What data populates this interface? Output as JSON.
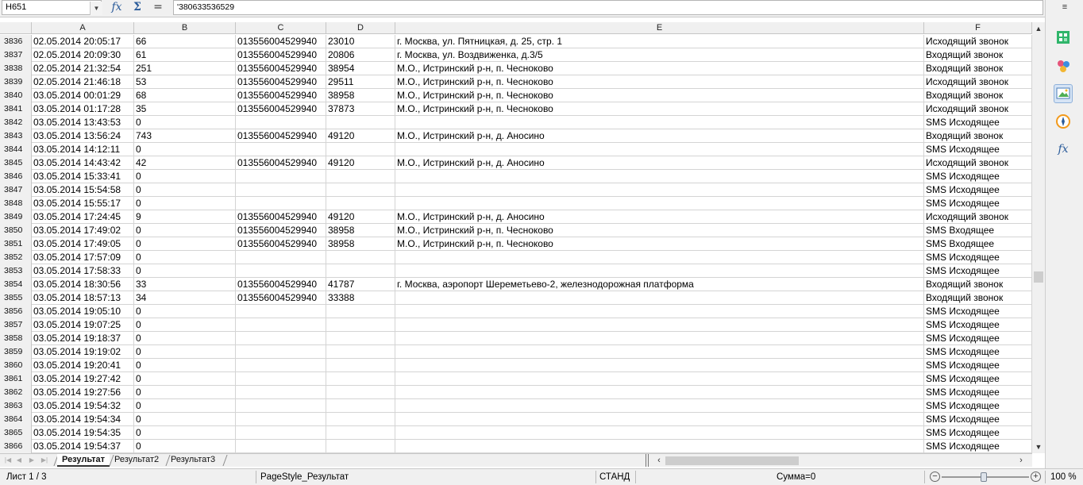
{
  "formula_bar": {
    "name_box": "H651",
    "formula_value": "'380633536529",
    "fx_label": "fx",
    "sum_label": "Σ",
    "equals_label": "="
  },
  "columns": [
    "A",
    "B",
    "C",
    "D",
    "E",
    "F"
  ],
  "rows": [
    {
      "n": "3836",
      "a": "02.05.2014 20:05:17",
      "b": "66",
      "c": "013556004529940",
      "d": "23010",
      "e": "г. Москва, ул. Пятницкая, д. 25, стр. 1",
      "f": "Исходящий звонок"
    },
    {
      "n": "3837",
      "a": "02.05.2014 20:09:30",
      "b": "61",
      "c": "013556004529940",
      "d": "20806",
      "e": "г. Москва, ул. Воздвиженка, д.3/5",
      "f": "Входящий звонок"
    },
    {
      "n": "3838",
      "a": "02.05.2014 21:32:54",
      "b": "251",
      "c": "013556004529940",
      "d": "38954",
      "e": "М.О., Истринский р-н, п. Чесноково",
      "f": "Входящий звонок"
    },
    {
      "n": "3839",
      "a": "02.05.2014 21:46:18",
      "b": "53",
      "c": "013556004529940",
      "d": "29511",
      "e": "М.О., Истринский р-н, п. Чесноково",
      "f": "Исходящий звонок"
    },
    {
      "n": "3840",
      "a": "03.05.2014 00:01:29",
      "b": "68",
      "c": "013556004529940",
      "d": "38958",
      "e": "М.О., Истринский р-н, п. Чесноково",
      "f": "Входящий звонок"
    },
    {
      "n": "3841",
      "a": "03.05.2014 01:17:28",
      "b": "35",
      "c": "013556004529940",
      "d": "37873",
      "e": "М.О., Истринский р-н, п. Чесноково",
      "f": "Исходящий звонок"
    },
    {
      "n": "3842",
      "a": "03.05.2014 13:43:53",
      "b": "0",
      "c": "",
      "d": "",
      "e": "",
      "f": "SMS Исходящее"
    },
    {
      "n": "3843",
      "a": "03.05.2014 13:56:24",
      "b": "743",
      "c": "013556004529940",
      "d": "49120",
      "e": "М.О., Истринский р-н, д. Аносино",
      "f": "Входящий звонок"
    },
    {
      "n": "3844",
      "a": "03.05.2014 14:12:11",
      "b": "0",
      "c": "",
      "d": "",
      "e": "",
      "f": "SMS Исходящее"
    },
    {
      "n": "3845",
      "a": "03.05.2014 14:43:42",
      "b": "42",
      "c": "013556004529940",
      "d": "49120",
      "e": "М.О., Истринский р-н, д. Аносино",
      "f": "Исходящий звонок"
    },
    {
      "n": "3846",
      "a": "03.05.2014 15:33:41",
      "b": "0",
      "c": "",
      "d": "",
      "e": "",
      "f": "SMS Исходящее"
    },
    {
      "n": "3847",
      "a": "03.05.2014 15:54:58",
      "b": "0",
      "c": "",
      "d": "",
      "e": "",
      "f": "SMS Исходящее"
    },
    {
      "n": "3848",
      "a": "03.05.2014 15:55:17",
      "b": "0",
      "c": "",
      "d": "",
      "e": "",
      "f": "SMS Исходящее"
    },
    {
      "n": "3849",
      "a": "03.05.2014 17:24:45",
      "b": "9",
      "c": "013556004529940",
      "d": "49120",
      "e": "М.О., Истринский р-н, д. Аносино",
      "f": "Исходящий звонок"
    },
    {
      "n": "3850",
      "a": "03.05.2014 17:49:02",
      "b": "0",
      "c": "013556004529940",
      "d": "38958",
      "e": "М.О., Истринский р-н, п. Чесноково",
      "f": "SMS Входящее"
    },
    {
      "n": "3851",
      "a": "03.05.2014 17:49:05",
      "b": "0",
      "c": "013556004529940",
      "d": "38958",
      "e": "М.О., Истринский р-н, п. Чесноково",
      "f": "SMS Входящее"
    },
    {
      "n": "3852",
      "a": "03.05.2014 17:57:09",
      "b": "0",
      "c": "",
      "d": "",
      "e": "",
      "f": "SMS Исходящее"
    },
    {
      "n": "3853",
      "a": "03.05.2014 17:58:33",
      "b": "0",
      "c": "",
      "d": "",
      "e": "",
      "f": "SMS Исходящее"
    },
    {
      "n": "3854",
      "a": "03.05.2014 18:30:56",
      "b": "33",
      "c": "013556004529940",
      "d": "41787",
      "e": "г. Москва, аэропорт Шереметьево-2, железнодорожная платформа",
      "f": "Входящий звонок"
    },
    {
      "n": "3855",
      "a": "03.05.2014 18:57:13",
      "b": "34",
      "c": "013556004529940",
      "d": "33388",
      "e": "",
      "f": "Входящий звонок"
    },
    {
      "n": "3856",
      "a": "03.05.2014 19:05:10",
      "b": "0",
      "c": "",
      "d": "",
      "e": "",
      "f": "SMS Исходящее"
    },
    {
      "n": "3857",
      "a": "03.05.2014 19:07:25",
      "b": "0",
      "c": "",
      "d": "",
      "e": "",
      "f": "SMS Исходящее"
    },
    {
      "n": "3858",
      "a": "03.05.2014 19:18:37",
      "b": "0",
      "c": "",
      "d": "",
      "e": "",
      "f": "SMS Исходящее"
    },
    {
      "n": "3859",
      "a": "03.05.2014 19:19:02",
      "b": "0",
      "c": "",
      "d": "",
      "e": "",
      "f": "SMS Исходящее"
    },
    {
      "n": "3860",
      "a": "03.05.2014 19:20:41",
      "b": "0",
      "c": "",
      "d": "",
      "e": "",
      "f": "SMS Исходящее"
    },
    {
      "n": "3861",
      "a": "03.05.2014 19:27:42",
      "b": "0",
      "c": "",
      "d": "",
      "e": "",
      "f": "SMS Исходящее"
    },
    {
      "n": "3862",
      "a": "03.05.2014 19:27:56",
      "b": "0",
      "c": "",
      "d": "",
      "e": "",
      "f": "SMS Исходящее"
    },
    {
      "n": "3863",
      "a": "03.05.2014 19:54:32",
      "b": "0",
      "c": "",
      "d": "",
      "e": "",
      "f": "SMS Исходящее"
    },
    {
      "n": "3864",
      "a": "03.05.2014 19:54:34",
      "b": "0",
      "c": "",
      "d": "",
      "e": "",
      "f": "SMS Исходящее"
    },
    {
      "n": "3865",
      "a": "03.05.2014 19:54:35",
      "b": "0",
      "c": "",
      "d": "",
      "e": "",
      "f": "SMS Исходящее"
    },
    {
      "n": "3866",
      "a": "03.05.2014 19:54:37",
      "b": "0",
      "c": "",
      "d": "",
      "e": "",
      "f": "SMS Исходящее"
    }
  ],
  "sheet_tabs": [
    "Результат",
    "Результат2",
    "Результат3"
  ],
  "active_tab": "Результат",
  "status": {
    "sheet": "Лист 1 / 3",
    "page_style": "PageStyle_Результат",
    "mode": "СТАНД",
    "sum": "Сумма=0",
    "zoom": "100 %"
  },
  "sidebar_icons": [
    "menu-icon",
    "properties-icon",
    "styles-icon",
    "gallery-icon",
    "navigator-icon",
    "functions-icon"
  ],
  "colors": {
    "chrome": "#f0f0f0",
    "grid_line": "#d4d4d4",
    "accent": "#2a5b9a"
  }
}
